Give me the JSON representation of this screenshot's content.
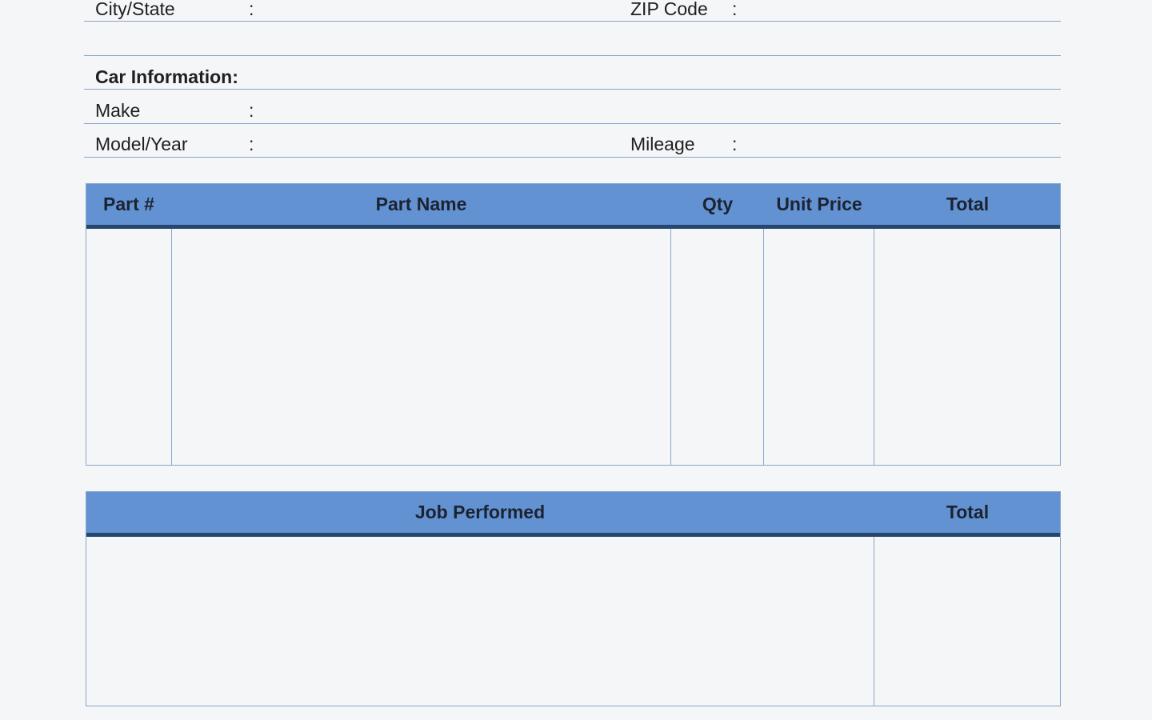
{
  "address": {
    "city_label": "City/State",
    "city_colon": ":",
    "zip_label": "ZIP Code",
    "zip_colon": ":"
  },
  "car": {
    "section_title": "Car Information:",
    "make_label": "Make",
    "make_colon": ":",
    "model_label": "Model/Year",
    "model_colon": ":",
    "mileage_label": "Mileage",
    "mileage_colon": ":"
  },
  "parts_table": {
    "columns": [
      "Part #",
      "Part Name",
      "Qty",
      "Unit Price",
      "Total"
    ]
  },
  "jobs_table": {
    "columns": [
      "Job Performed",
      "Total"
    ]
  },
  "colors": {
    "header_fill": "#6392d3",
    "header_rule": "#26456f",
    "line": "#8aa6c9",
    "page_bg": "#f5f6f7"
  }
}
